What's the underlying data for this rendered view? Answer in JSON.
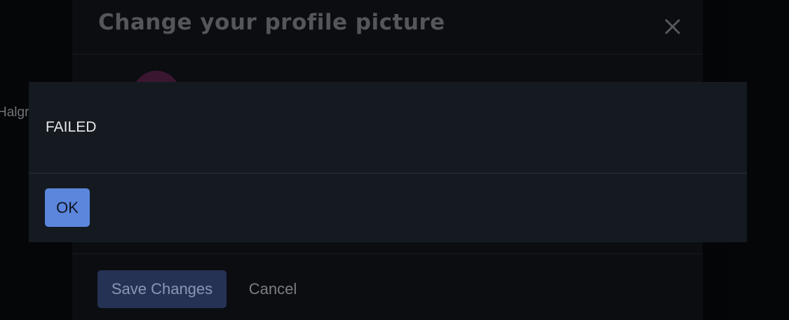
{
  "background": {
    "side_text": "Halgr"
  },
  "profile_modal": {
    "title": "Change your profile picture",
    "close_icon": "close-icon",
    "save_label": "Save Changes",
    "cancel_label": "Cancel"
  },
  "alert": {
    "message": "FAILED",
    "ok_label": "OK"
  },
  "colors": {
    "page_bg": "#050608",
    "modal_bg": "#0b0d11",
    "alert_bg": "#151a21",
    "ok_button": "#5b86dc",
    "save_button": "#253254",
    "avatar": "#3a1630"
  }
}
